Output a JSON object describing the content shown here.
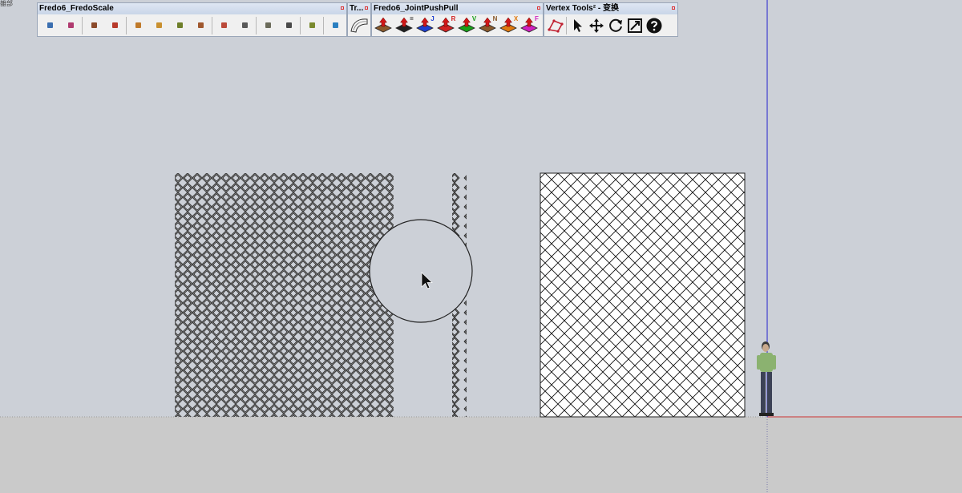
{
  "corner_label": "雒部",
  "toolbars": {
    "fredo_scale": {
      "title": "Fredo6_FredoScale",
      "buttons": [
        {
          "name": "scale-tool-1-icon",
          "color": "#3b6fb0"
        },
        {
          "name": "scale-tool-2-icon",
          "color": "#b03b70"
        },
        {
          "name": "scale-tool-3-icon",
          "color": "#8b4a2b"
        },
        {
          "name": "scale-tool-4-icon",
          "color": "#b83a2b"
        },
        {
          "name": "scale-tool-5-icon",
          "color": "#c07a2a"
        },
        {
          "name": "scale-tool-6-icon",
          "color": "#c9902f"
        },
        {
          "name": "scale-tool-7-icon",
          "color": "#6e7f2a"
        },
        {
          "name": "scale-tool-8-icon",
          "color": "#a0582e"
        },
        {
          "name": "scale-tool-9-icon",
          "color": "#bb4a3a"
        },
        {
          "name": "scale-tool-10-icon",
          "color": "#595959"
        },
        {
          "name": "scale-tool-11-icon",
          "color": "#6b6b5a"
        },
        {
          "name": "scale-tool-12-icon",
          "color": "#4a4a4a"
        },
        {
          "name": "scale-tool-13-icon",
          "color": "#7a8a2e"
        },
        {
          "name": "scale-tool-14-icon",
          "color": "#2a7fc0"
        }
      ]
    },
    "tr": {
      "title": "Tr..."
    },
    "joint_push_pull": {
      "title": "Fredo6_JointPushPull",
      "buttons": [
        {
          "name": "joint-push-pull-icon",
          "letter": "",
          "color": "#8a5a2c"
        },
        {
          "name": "normal-push-pull-icon",
          "letter": "=",
          "color": "#222222"
        },
        {
          "name": "joint-j-push-pull-icon",
          "letter": "J",
          "color": "#1d3fd0"
        },
        {
          "name": "round-push-pull-icon",
          "letter": "R",
          "color": "#d02222"
        },
        {
          "name": "vector-push-pull-icon",
          "letter": "V",
          "color": "#18a018"
        },
        {
          "name": "normal-n-push-pull-icon",
          "letter": "N",
          "color": "#8a5a2c"
        },
        {
          "name": "extrude-x-push-pull-icon",
          "letter": "X",
          "color": "#e07a10"
        },
        {
          "name": "follow-push-pull-icon",
          "letter": "F",
          "color": "#d020c0"
        }
      ]
    },
    "vertex_tools": {
      "title": "Vertex Tools² - 变换",
      "buttons": [
        {
          "name": "vertex-select-icon"
        },
        {
          "name": "pointer-icon"
        },
        {
          "name": "move-icon"
        },
        {
          "name": "rotate-icon"
        },
        {
          "name": "scale-icon"
        },
        {
          "name": "help-icon"
        }
      ]
    }
  },
  "colors": {
    "sky": "#ccd0d7",
    "ground": "#cacaca",
    "blue_axis": "#2222cc",
    "red_axis": "#cc3333",
    "green_axis": "#33aa33"
  }
}
